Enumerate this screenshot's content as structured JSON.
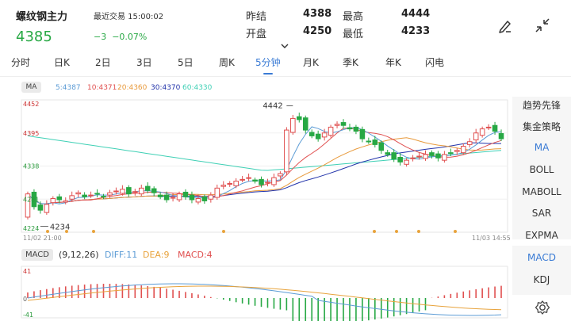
{
  "header": {
    "title": "螺纹钢主力",
    "last_trade_label": "最近交易 15:00:02",
    "price": "4385",
    "change": "−3",
    "change_pct": "−0.07%",
    "prev_close_label": "昨结",
    "prev_close": "4388",
    "high_label": "最高",
    "high": "4444",
    "open_label": "开盘",
    "open": "4250",
    "low_label": "最低",
    "low": "4233",
    "more_icon": "chevron-down-icon",
    "edit_icon": "pen-icon",
    "collapse_icon": "collapse-arrows-icon"
  },
  "tabs": [
    {
      "label": "分时"
    },
    {
      "label": "日K"
    },
    {
      "label": "2日"
    },
    {
      "label": "3日"
    },
    {
      "label": "5日"
    },
    {
      "label": "周K"
    },
    {
      "label": "5分钟"
    },
    {
      "label": "月K"
    },
    {
      "label": "季K"
    },
    {
      "label": "年K"
    },
    {
      "label": "闪电"
    }
  ],
  "active_tab": "5分钟",
  "ma": {
    "pill": "MA",
    "items": [
      {
        "label": "5:4387",
        "color": "#5b9bd5"
      },
      {
        "label": "10:4371",
        "color": "#e05050"
      },
      {
        "label": "20:4360",
        "color": "#e89a3c"
      },
      {
        "label": "30:4370",
        "color": "#2233aa"
      },
      {
        "label": "60:4330",
        "color": "#3fd0b5"
      }
    ]
  },
  "macd": {
    "pill": "MACD",
    "params": "(9,12,26)",
    "items": [
      {
        "label": "DIFF:11",
        "color": "#5b9bd5"
      },
      {
        "label": "DEA:9",
        "color": "#e8a33c"
      },
      {
        "label": "MACD:4",
        "color": "#e05050"
      }
    ],
    "axis_top": "41",
    "axis_zero": "0",
    "axis_bottom": "-41"
  },
  "price_axis": {
    "top": "4452",
    "upper": "4395",
    "mid": "4338",
    "lower": "4281",
    "bottom": "4224"
  },
  "annotations": {
    "high_mark": "4442",
    "low_mark": "4234"
  },
  "time_axis": {
    "start": "11/02 21:00",
    "end": "11/03 14:55"
  },
  "sidebar": [
    {
      "label": "趋势先锋"
    },
    {
      "label": "集金策略"
    },
    {
      "label": "MA"
    },
    {
      "label": "BOLL"
    },
    {
      "label": "MABOLL"
    },
    {
      "label": "SAR"
    },
    {
      "label": "EXPMA"
    },
    {
      "label": "MACD"
    },
    {
      "label": "KDJ"
    }
  ],
  "settings_icon": "gear-icon",
  "colors": {
    "up": "#e05050",
    "down": "#27a844",
    "accent": "#3a7bd5"
  }
}
